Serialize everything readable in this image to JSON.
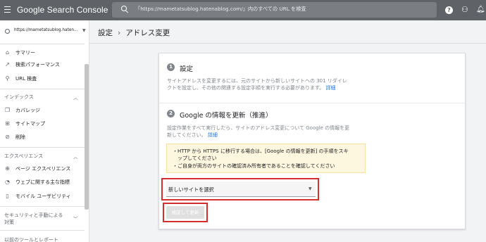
{
  "app": {
    "title": "Google Search Console"
  },
  "search": {
    "placeholder": "「https://mametatsublog.hatenablog.com/」内のすべての URL を検査"
  },
  "header_icons": [
    "help-icon",
    "manage-users-icon",
    "notifications-icon"
  ],
  "sidebar": {
    "property": "https://mametatsublog.haten...",
    "top_items": [
      {
        "label": "サマリー",
        "icon": "home-icon"
      },
      {
        "label": "検索パフォーマンス",
        "icon": "trend-icon"
      },
      {
        "label": "URL 検査",
        "icon": "search-icon"
      }
    ],
    "index_section": {
      "title": "インデックス",
      "items": [
        {
          "label": "カバレッジ",
          "icon": "coverage-icon"
        },
        {
          "label": "サイトマップ",
          "icon": "sitemap-icon"
        },
        {
          "label": "削除",
          "icon": "removal-icon"
        }
      ]
    },
    "experience_section": {
      "title": "エクスペリエンス",
      "items": [
        {
          "label": "ページ エクスペリエンス",
          "icon": "page-experience-icon"
        },
        {
          "label": "ウェブに関する主な指標",
          "icon": "web-vitals-icon"
        },
        {
          "label": "モバイル ユーザビリティ",
          "icon": "mobile-icon"
        }
      ]
    },
    "security_section": {
      "title_line1": "セキュリティと手動による",
      "title_line2": "対策"
    },
    "legacy_section": {
      "title": "以前のツールとレポート"
    }
  },
  "breadcrumb": {
    "parent": "設定",
    "separator": "›",
    "current": "アドレス変更"
  },
  "steps": [
    {
      "number": "1",
      "title": "設定",
      "desc_line1": "サイトアドレスを変更するには、元のサイトから新しいサイトへの 301 リダイレ",
      "desc_line2": "クトを設定し、その他の関連する設定手順を実行する必要があります。",
      "link": "詳細"
    },
    {
      "number": "2",
      "title": "Google の情報を更新（推進）",
      "desc_line1": "設定作業をすべて実行したら、サイトのアドレス変更について Google の情報を更",
      "desc_line2": "新してください。",
      "link": "詳細"
    }
  ],
  "warning": {
    "line1": "・HTTP から HTTPS に移行する場合は、[Google の情報を更新] の手順をスキ",
    "line2": "　ップしてください",
    "line3": "・ご自身が両方のサイトの確認済み所有者であることを確認してください"
  },
  "select": {
    "value": "新しいサイトを選択"
  },
  "submit": {
    "label": "検証して更新"
  },
  "colors": {
    "topbar": "#5f6368",
    "highlight": "#d32f2f",
    "link": "#1a73e8",
    "warning_bg": "#fef7e0"
  }
}
